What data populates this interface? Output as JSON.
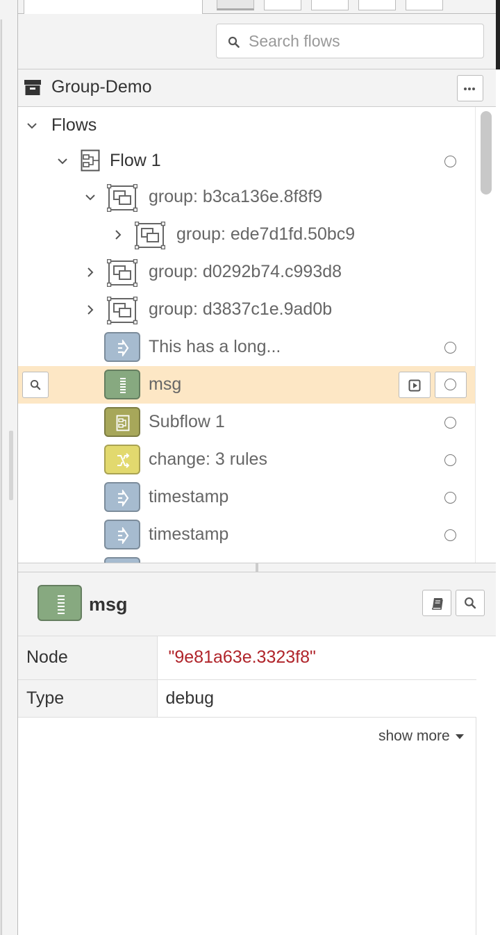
{
  "search": {
    "placeholder": "Search flows"
  },
  "project": {
    "title": "Group-Demo"
  },
  "tree": {
    "flows_label": "Flows",
    "flow_label": "Flow 1",
    "groups": [
      "group: b3ca136e.8f8f9",
      "group: ede7d1fd.50bc9",
      "group: d0292b74.c993d8",
      "group: d3837c1e.9ad0b"
    ],
    "nodes": [
      {
        "label": "This has a long...",
        "type": "inject",
        "color": "#a6bbcf"
      },
      {
        "label": "msg",
        "type": "debug",
        "color": "#87a980"
      },
      {
        "label": "Subflow 1",
        "type": "subflow",
        "color": "#a7a75a"
      },
      {
        "label": "change: 3 rules",
        "type": "change",
        "color": "#e2d96e"
      },
      {
        "label": "timestamp",
        "type": "inject",
        "color": "#a6bbcf"
      },
      {
        "label": "timestamp",
        "type": "inject",
        "color": "#a6bbcf"
      }
    ]
  },
  "info": {
    "title": "msg",
    "rows": [
      {
        "key": "Node",
        "value": "\"9e81a63e.3323f8\""
      },
      {
        "key": "Type",
        "value": "debug"
      }
    ],
    "show_more": "show more"
  }
}
